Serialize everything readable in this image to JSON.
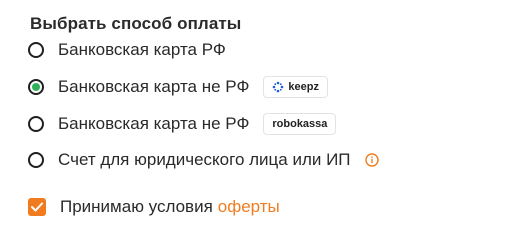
{
  "form": {
    "title": "Выбрать способ оплаты",
    "options": [
      {
        "label": "Банковская карта РФ",
        "checked": false
      },
      {
        "label": "Банковская карта не РФ",
        "checked": true,
        "badge": "keepz",
        "badge_icon": "keepz-logo-icon"
      },
      {
        "label": "Банковская карта не РФ",
        "checked": false,
        "badge": "robokassa"
      },
      {
        "label": "Счет для юридического лица или ИП",
        "checked": false,
        "icon": "info-icon"
      }
    ],
    "agreement": {
      "checked": true,
      "text": "Принимаю условия",
      "link": "оферты"
    }
  },
  "colors": {
    "accent": "#f07c1f",
    "radio_selected": "#2fb35a",
    "text": "#2a2a2a"
  }
}
